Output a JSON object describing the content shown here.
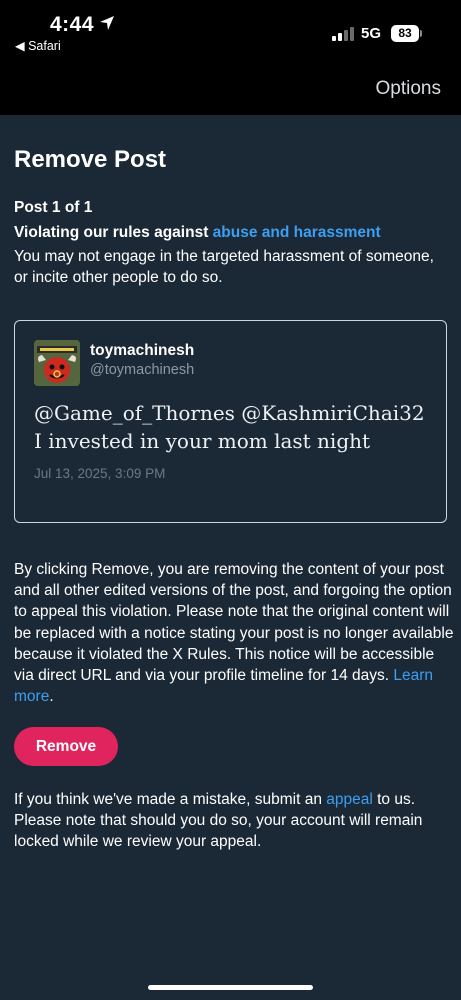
{
  "status_bar": {
    "time": "4:44",
    "back_app": "◀ Safari",
    "network": "5G",
    "battery": "83"
  },
  "header": {
    "options_label": "Options"
  },
  "page": {
    "title": "Remove Post",
    "post_count": "Post 1 of 1",
    "rule_prefix": "Violating our rules against ",
    "rule_link": "abuse and harassment",
    "rule_description": "You may not engage in the targeted harassment of someone, or incite other people to do so."
  },
  "post": {
    "author_name": "toymachinesh",
    "author_handle": "@toymachinesh",
    "text_line1": "@Game_of_Thornes @KashmiriChai32",
    "text_line2": "I invested in your mom last night",
    "date": "Jul 13, 2025, 3:09 PM"
  },
  "notice": {
    "body": "By clicking Remove, you are removing the content of your post and all other edited versions of the post, and forgoing the option to appeal this violation. Please note that the original content will be replaced with a notice stating your post is no longer available because it violated the X Rules. This notice will be accessible via direct URL and via your profile timeline for 14 days. ",
    "learn_more": "Learn more",
    "period": "."
  },
  "actions": {
    "remove_label": "Remove"
  },
  "appeal": {
    "prefix": "If you think we've made a mistake, submit an ",
    "link": "appeal",
    "suffix": " to us. Please note that should you do so, your account will remain locked while we review your appeal."
  },
  "colors": {
    "background": "#1b2836",
    "accent_link": "#3c9ff0",
    "remove_button": "#e0245e"
  }
}
